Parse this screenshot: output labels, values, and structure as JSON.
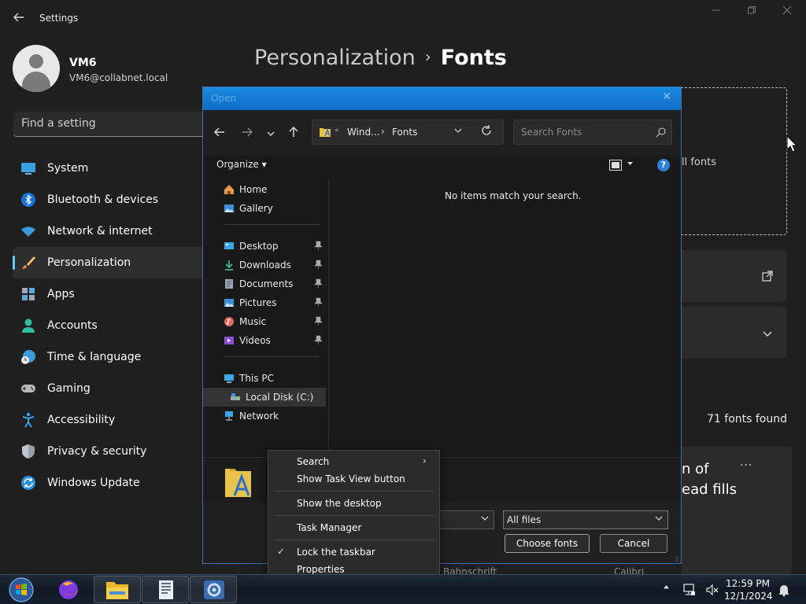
{
  "settings": {
    "app_title": "Settings",
    "user": {
      "name": "VM6",
      "email": "VM6@collabnet.local"
    },
    "search_placeholder": "Find a setting",
    "nav": [
      {
        "label": "System",
        "icon": "system-icon"
      },
      {
        "label": "Bluetooth & devices",
        "icon": "bluetooth-icon"
      },
      {
        "label": "Network & internet",
        "icon": "wifi-icon"
      },
      {
        "label": "Personalization",
        "icon": "brush-icon",
        "active": true
      },
      {
        "label": "Apps",
        "icon": "apps-icon"
      },
      {
        "label": "Accounts",
        "icon": "accounts-icon"
      },
      {
        "label": "Time & language",
        "icon": "time-language-icon"
      },
      {
        "label": "Gaming",
        "icon": "gamepad-icon"
      },
      {
        "label": "Accessibility",
        "icon": "accessibility-icon"
      },
      {
        "label": "Privacy & security",
        "icon": "shield-icon"
      },
      {
        "label": "Windows Update",
        "icon": "update-icon"
      }
    ],
    "breadcrumb": {
      "parent": "Personalization",
      "separator": "›",
      "current": "Fonts"
    },
    "drop_text": "ll fonts",
    "fonts_found": "71 fonts found",
    "preview_line1": "n of",
    "preview_line2": "ead fills",
    "more": "···"
  },
  "dialog": {
    "title": "Open",
    "close": "✕",
    "address": {
      "root_glyph": "«",
      "segment1": "Wind...",
      "arrow": "›",
      "segment2": "Fonts"
    },
    "search_placeholder": "Search Fonts",
    "organize_label": "Organize ▾",
    "help": "?",
    "tree": [
      {
        "label": "Home",
        "icon": "home-icon"
      },
      {
        "label": "Gallery",
        "icon": "gallery-icon"
      },
      {
        "label": "Desktop",
        "icon": "desktop-icon",
        "pinned": true
      },
      {
        "label": "Downloads",
        "icon": "downloads-icon",
        "pinned": true
      },
      {
        "label": "Documents",
        "icon": "documents-icon",
        "pinned": true
      },
      {
        "label": "Pictures",
        "icon": "pictures-icon",
        "pinned": true
      },
      {
        "label": "Music",
        "icon": "music-icon",
        "pinned": true
      },
      {
        "label": "Videos",
        "icon": "videos-icon",
        "pinned": true
      },
      {
        "label": "This PC",
        "icon": "this-pc-icon"
      },
      {
        "label": "Local Disk (C:)",
        "icon": "local-disk-icon",
        "selected": true
      },
      {
        "label": "Network",
        "icon": "network-icon"
      }
    ],
    "empty_message": "No items match your search.",
    "file_type": "All files",
    "choose_label": "Choose fonts",
    "cancel_label": "Cancel"
  },
  "context_menu": {
    "items": [
      {
        "label": "Search",
        "submenu": "›"
      },
      {
        "label": "Show Task View button"
      },
      {
        "label": "Show the desktop"
      },
      {
        "label": "Task Manager"
      },
      {
        "label": "Lock the taskbar",
        "check": "✓"
      },
      {
        "label": "Properties"
      }
    ]
  },
  "behind": {
    "left": "Bahnschrift",
    "right": "Calibri"
  },
  "taskbar": {
    "time": "12:59 PM",
    "date": "12/1/2024",
    "apps": [
      "firefox-icon",
      "file-explorer-icon",
      "document-app-icon",
      "settings-app-icon"
    ]
  },
  "colors": {
    "accent": "#60cdff",
    "dialog_title": "#0f6dc6",
    "help_blue": "#2e7fd8"
  }
}
